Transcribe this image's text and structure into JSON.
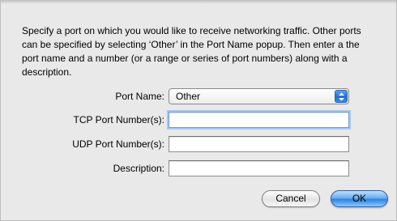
{
  "description": "Specify a port on which you would like to receive networking traffic. Other ports can be specified by selecting ‘Other’ in the Port Name popup. Then enter a the port name and a number (or a range or series of port numbers) along with a description.",
  "form": {
    "port_name_label": "Port Name:",
    "port_name_value": "Other",
    "tcp_label": "TCP Port Number(s):",
    "tcp_value": "",
    "udp_label": "UDP Port Number(s):",
    "udp_value": "",
    "description_label": "Description:",
    "description_value": ""
  },
  "buttons": {
    "cancel": "Cancel",
    "ok": "OK"
  },
  "colors": {
    "accent": "#2f83e0",
    "focus_ring": "#a8c8ee"
  },
  "icons": {
    "popup_arrows": "up-down-arrows-icon"
  }
}
